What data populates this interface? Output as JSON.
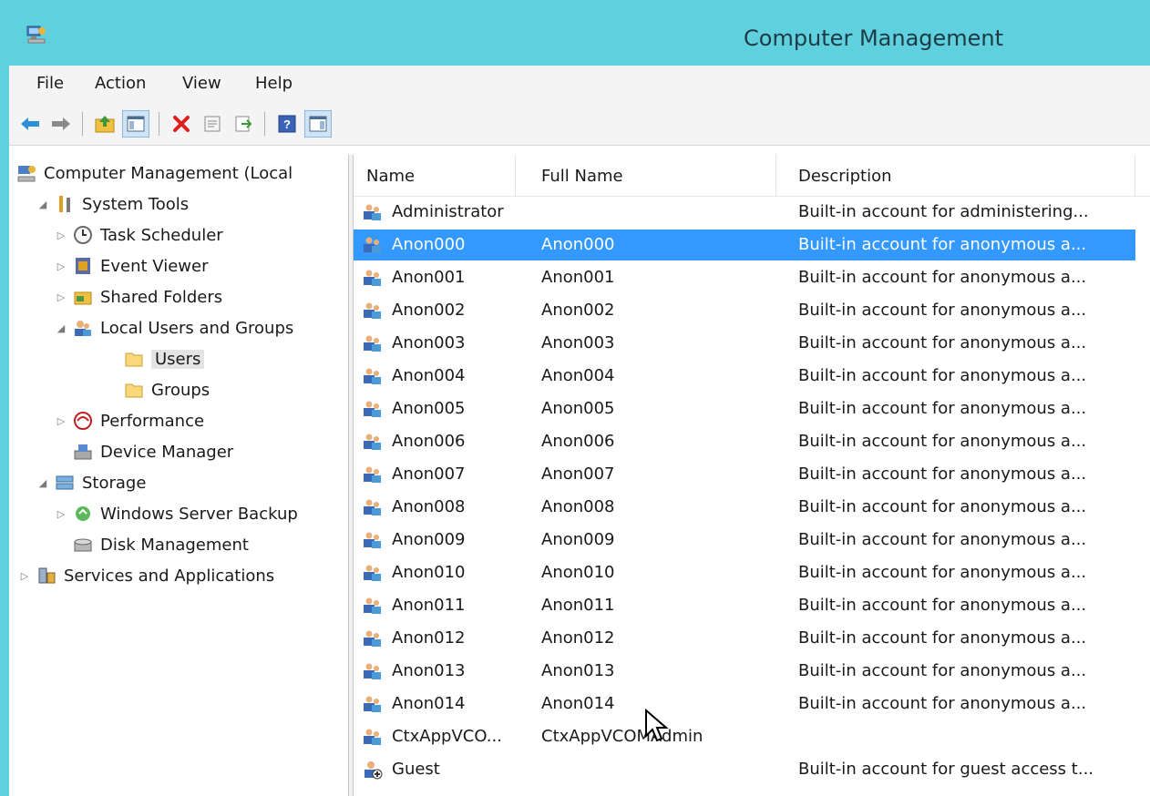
{
  "window": {
    "title": "Computer Management"
  },
  "menu": [
    "File",
    "Action",
    "View",
    "Help"
  ],
  "toolbar": {
    "buttons": [
      "back-icon",
      "forward-icon",
      "up-folder-icon",
      "show-hide-console-tree-icon",
      "delete-icon",
      "properties-icon",
      "export-list-icon",
      "help-icon",
      "show-hide-action-pane-icon"
    ]
  },
  "tree": {
    "items": [
      {
        "label": "Computer Management (Local",
        "arrow": ""
      },
      {
        "label": "System Tools",
        "arrow": "◢"
      },
      {
        "label": "Task Scheduler",
        "arrow": "▷"
      },
      {
        "label": "Event Viewer",
        "arrow": "▷"
      },
      {
        "label": "Shared Folders",
        "arrow": "▷"
      },
      {
        "label": "Local Users and Groups",
        "arrow": "◢"
      },
      {
        "label": "Users",
        "arrow": ""
      },
      {
        "label": "Groups",
        "arrow": ""
      },
      {
        "label": "Performance",
        "arrow": "▷"
      },
      {
        "label": "Device Manager",
        "arrow": ""
      },
      {
        "label": "Storage",
        "arrow": "◢"
      },
      {
        "label": "Windows Server Backup",
        "arrow": "▷"
      },
      {
        "label": "Disk Management",
        "arrow": ""
      },
      {
        "label": "Services and Applications",
        "arrow": "▷"
      }
    ]
  },
  "list": {
    "columns": [
      "Name",
      "Full Name",
      "Description"
    ],
    "rows": [
      {
        "name": "Administrator",
        "full_name": "",
        "description": "Built-in account for administering..."
      },
      {
        "name": "Anon000",
        "full_name": "Anon000",
        "description": "Built-in account for anonymous a..."
      },
      {
        "name": "Anon001",
        "full_name": "Anon001",
        "description": "Built-in account for anonymous a..."
      },
      {
        "name": "Anon002",
        "full_name": "Anon002",
        "description": "Built-in account for anonymous a..."
      },
      {
        "name": "Anon003",
        "full_name": "Anon003",
        "description": "Built-in account for anonymous a..."
      },
      {
        "name": "Anon004",
        "full_name": "Anon004",
        "description": "Built-in account for anonymous a..."
      },
      {
        "name": "Anon005",
        "full_name": "Anon005",
        "description": "Built-in account for anonymous a..."
      },
      {
        "name": "Anon006",
        "full_name": "Anon006",
        "description": "Built-in account for anonymous a..."
      },
      {
        "name": "Anon007",
        "full_name": "Anon007",
        "description": "Built-in account for anonymous a..."
      },
      {
        "name": "Anon008",
        "full_name": "Anon008",
        "description": "Built-in account for anonymous a..."
      },
      {
        "name": "Anon009",
        "full_name": "Anon009",
        "description": "Built-in account for anonymous a..."
      },
      {
        "name": "Anon010",
        "full_name": "Anon010",
        "description": "Built-in account for anonymous a..."
      },
      {
        "name": "Anon011",
        "full_name": "Anon011",
        "description": "Built-in account for anonymous a..."
      },
      {
        "name": "Anon012",
        "full_name": "Anon012",
        "description": "Built-in account for anonymous a..."
      },
      {
        "name": "Anon013",
        "full_name": "Anon013",
        "description": "Built-in account for anonymous a..."
      },
      {
        "name": "Anon014",
        "full_name": "Anon014",
        "description": "Built-in account for anonymous a..."
      },
      {
        "name": "CtxAppVCO...",
        "full_name": "CtxAppVCOMAdmin",
        "description": ""
      },
      {
        "name": "Guest",
        "full_name": "",
        "description": "Built-in account for guest access t..."
      }
    ]
  },
  "colors": {
    "titlebar": "#5fd0de",
    "selection": "#3399ff"
  }
}
